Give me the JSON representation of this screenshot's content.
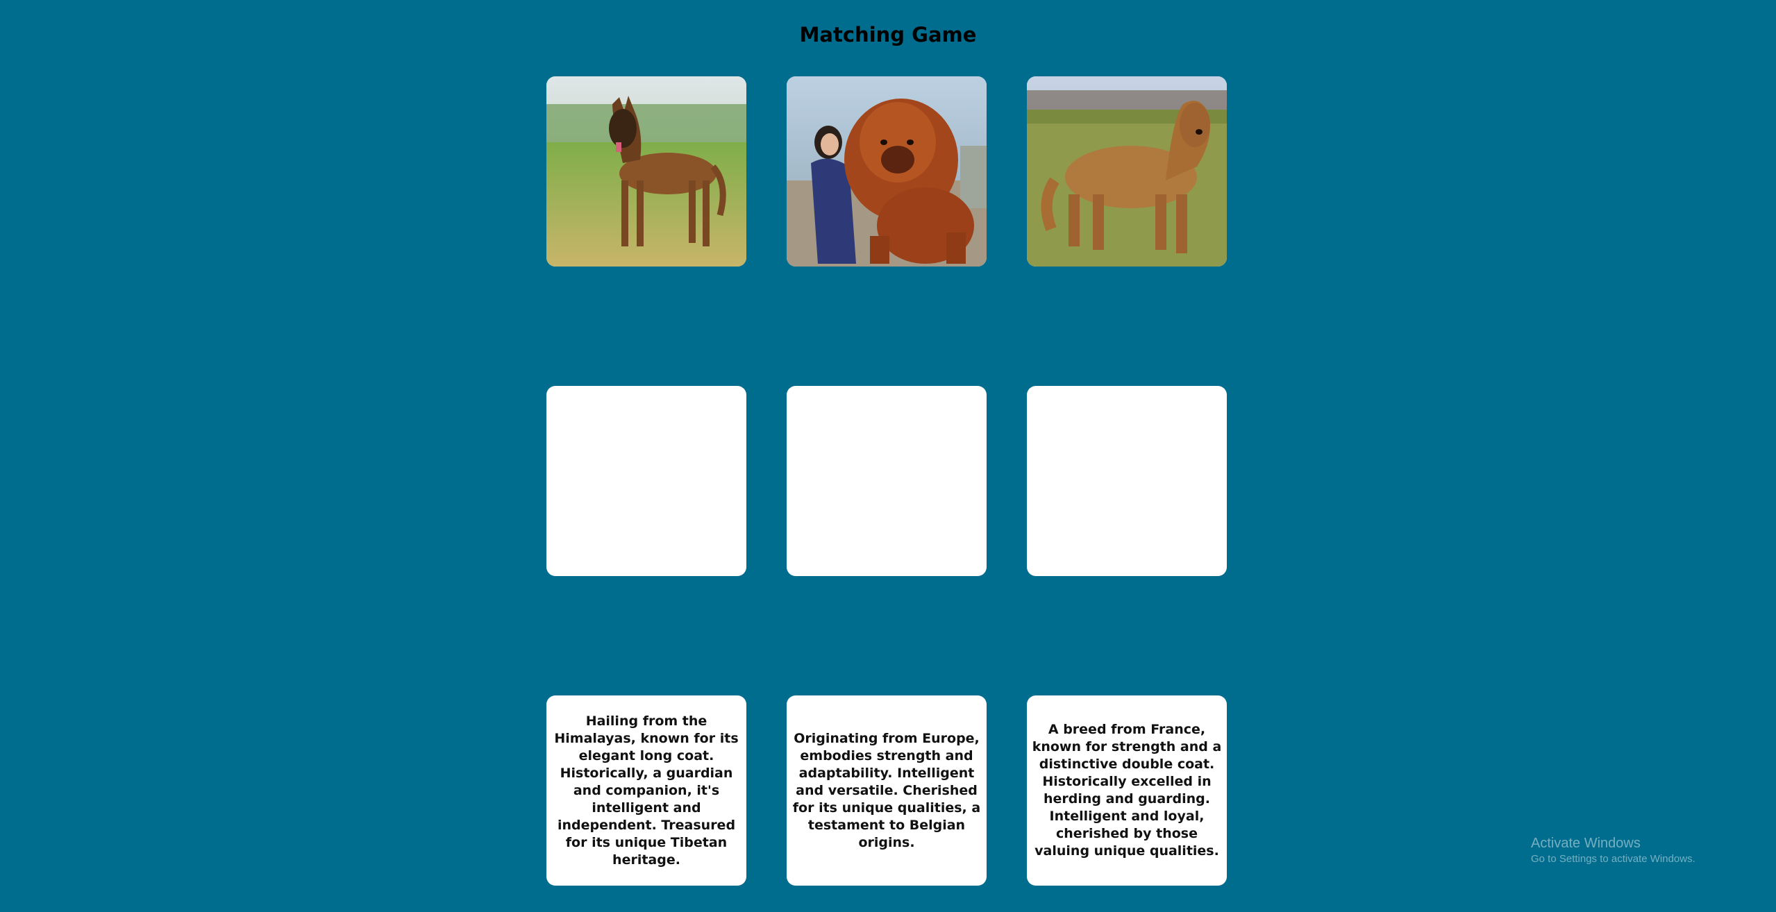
{
  "page": {
    "title": "Matching Game",
    "background_color": "#006d8f"
  },
  "cards": {
    "images": [
      {
        "picture": "belgian-malinois-dog"
      },
      {
        "picture": "tibetan-mastiff-dog"
      },
      {
        "picture": "briard-dog"
      }
    ],
    "blanks": [
      {},
      {},
      {}
    ],
    "descriptions": [
      {
        "text": "Hailing from the Himalayas, known for its elegant long coat. Historically, a guardian and companion, it's intelligent and independent. Treasured for its unique Tibetan heritage."
      },
      {
        "text": "Originating from Europe, embodies strength and adaptability. Intelligent and versatile. Cherished for its unique qualities, a testament to Belgian origins."
      },
      {
        "text": "A breed from France, known for strength and a distinctive double coat. Historically excelled in herding and guarding. Intelligent and loyal, cherished by those valuing unique qualities."
      }
    ]
  },
  "watermark": {
    "title": "Activate Windows",
    "subtitle": "Go to Settings to activate Windows."
  }
}
